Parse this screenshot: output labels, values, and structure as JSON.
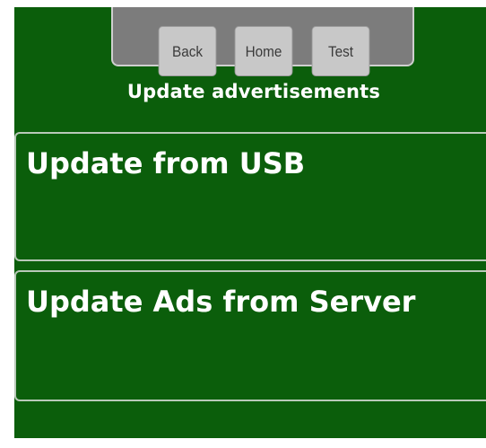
{
  "nav": {
    "back_label": "Back",
    "home_label": "Home",
    "test_label": "Test"
  },
  "page": {
    "title": "Update advertisements"
  },
  "options": [
    {
      "label": "Update from USB"
    },
    {
      "label": "Update Ads from Server"
    }
  ],
  "colors": {
    "background": "#0b5e0b",
    "nav_tray": "#7c7c7c",
    "nav_button": "#c8c8c8",
    "text": "#ffffff"
  }
}
